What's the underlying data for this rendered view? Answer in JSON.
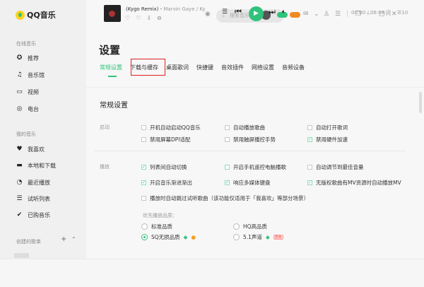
{
  "app": {
    "name": "QQ音乐"
  },
  "sidebar": {
    "online_title": "在线音乐",
    "online": [
      {
        "label": "推荐",
        "icon": "star-circle-icon"
      },
      {
        "label": "音乐馆",
        "icon": "music-note-icon"
      },
      {
        "label": "视频",
        "icon": "video-icon"
      },
      {
        "label": "电台",
        "icon": "radio-icon"
      }
    ],
    "my_title": "我的音乐",
    "my": [
      {
        "label": "我喜欢",
        "icon": "heart-icon"
      },
      {
        "label": "本地和下载",
        "icon": "monitor-icon"
      },
      {
        "label": "最近播放",
        "icon": "clock-icon"
      },
      {
        "label": "试听列表",
        "icon": "playlist-icon"
      },
      {
        "label": "已购音乐",
        "icon": "check-circle-icon"
      }
    ],
    "created_title": "创建的歌单"
  },
  "header": {
    "search_placeholder": "搜索音乐"
  },
  "settings": {
    "title": "设置",
    "tabs": [
      "常规设置",
      "下载与缓存",
      "桌面歌词",
      "快捷键",
      "音效插件",
      "网络设置",
      "音频设备"
    ],
    "section_title": "常规设置",
    "startup": {
      "label": "启动",
      "options": [
        {
          "text": "开机自动启动QQ音乐",
          "checked": false
        },
        {
          "text": "自动播放歌曲",
          "checked": false
        },
        {
          "text": "自动打开歌词",
          "checked": false
        },
        {
          "text": "禁用屏幕DPI适配",
          "checked": false
        },
        {
          "text": "禁用触屏播控手势",
          "checked": false
        },
        {
          "text": "禁用硬件加速",
          "checked": true
        }
      ]
    },
    "playback": {
      "label": "播放",
      "options": [
        {
          "text": "列表间自动切换",
          "checked": true
        },
        {
          "text": "开启手机遥控电脑播歌",
          "checked": false
        },
        {
          "text": "自动调节到最佳音量",
          "checked": false
        },
        {
          "text": "开启音乐渐进渐出",
          "checked": true
        },
        {
          "text": "响应多媒体键盘",
          "checked": true
        },
        {
          "text": "无版权歌曲有MV资源时自动播放MV",
          "checked": true
        },
        {
          "text": "播放时自动跳过试听歌曲（该功能仅适用于「我喜欢」等部分场景）",
          "checked": false
        }
      ]
    },
    "quality": {
      "label": "优先播放品质：",
      "options": [
        {
          "text": "标准品质",
          "selected": false
        },
        {
          "text": "HQ高品质",
          "selected": false
        },
        {
          "text": "SQ无损品质",
          "selected": true
        },
        {
          "text": "5.1声道",
          "selected": false,
          "tag": "限免"
        }
      ]
    }
  },
  "player": {
    "song": "(Kygo Remix)",
    "artist": "Marvin Gaye / Ky",
    "time": "00:00 / 06:08",
    "lyrics_label": "词",
    "playlist_count": "10"
  },
  "colors": {
    "accent": "#31c27c",
    "highlight": "#e02020"
  }
}
